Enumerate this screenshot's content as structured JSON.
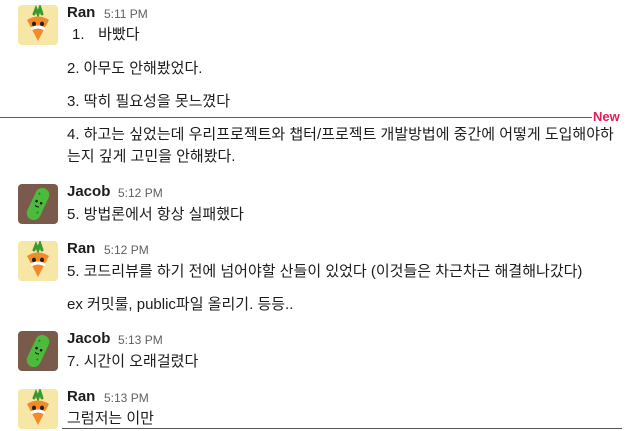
{
  "colors": {
    "accent": "#e01e5a",
    "timestamp": "#616061",
    "text": "#1d1c1d"
  },
  "divider": {
    "label": "New"
  },
  "messages": [
    {
      "author": "Ran",
      "time": "5:11 PM",
      "avatar_icon": "carrot-avatar-icon",
      "lines": [
        {
          "num": "1.",
          "text": "바빴다"
        },
        {
          "text": "2. 아무도 안해봤었다."
        },
        {
          "text": "3. 딱히 필요성을 못느꼈다"
        },
        {
          "text": "4. 하고는 싶었는데 우리프로젝트와 챕터/프로젝트 개발방법에 중간에 어떻게 도입해야하는지 깊게 고민을 안해봤다."
        }
      ]
    },
    {
      "author": "Jacob",
      "time": "5:12 PM",
      "avatar_icon": "cucumber-avatar-icon",
      "lines": [
        {
          "text": "5. 방법론에서 항상 실패했다"
        }
      ]
    },
    {
      "author": "Ran",
      "time": "5:12 PM",
      "avatar_icon": "carrot-avatar-icon",
      "lines": [
        {
          "text": "5. 코드리뷰를 하기 전에 넘어야할 산들이 있었다 (이것들은 차근차근 해결해나갔다)"
        },
        {
          "text": "ex 커밋룰, public파일 올리기. 등등.."
        }
      ]
    },
    {
      "author": "Jacob",
      "time": "5:13 PM",
      "avatar_icon": "cucumber-avatar-icon",
      "lines": [
        {
          "text": "7. 시간이 오래걸렸다"
        }
      ]
    },
    {
      "author": "Ran",
      "time": "5:13 PM",
      "avatar_icon": "carrot-avatar-icon",
      "lines": [
        {
          "text": "그럼저는 이만"
        }
      ]
    }
  ]
}
